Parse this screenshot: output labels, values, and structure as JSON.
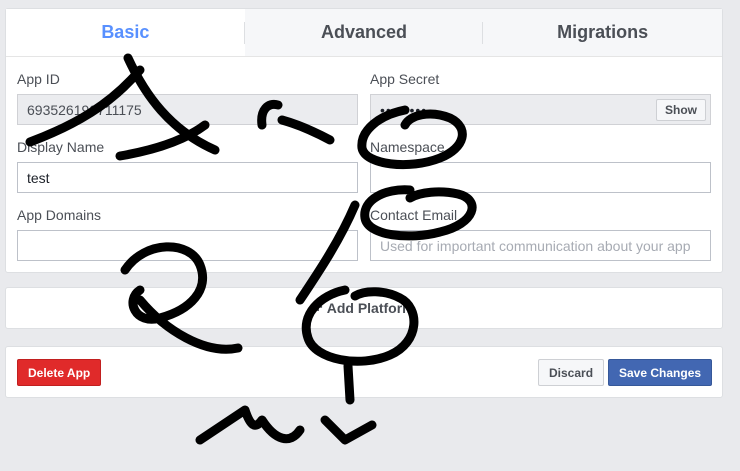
{
  "tabs": [
    {
      "label": "Basic",
      "active": true
    },
    {
      "label": "Advanced",
      "active": false
    },
    {
      "label": "Migrations",
      "active": false
    }
  ],
  "fields": {
    "app_id": {
      "label": "App ID",
      "value": "693526190711175"
    },
    "app_secret": {
      "label": "App Secret",
      "value": "••••••••",
      "show_label": "Show"
    },
    "display_name": {
      "label": "Display Name",
      "value": "test"
    },
    "namespace": {
      "label": "Namespace",
      "value": ""
    },
    "app_domains": {
      "label": "App Domains",
      "value": ""
    },
    "contact_email": {
      "label": "Contact Email",
      "placeholder": "Used for important communication about your app"
    }
  },
  "platform": {
    "add_label": "Add Platform"
  },
  "footer": {
    "delete_label": "Delete App",
    "discard_label": "Discard",
    "save_label": "Save Changes"
  },
  "colors": {
    "accent": "#5890ff",
    "delete": "#e02a2a",
    "save": "#4267b2"
  }
}
